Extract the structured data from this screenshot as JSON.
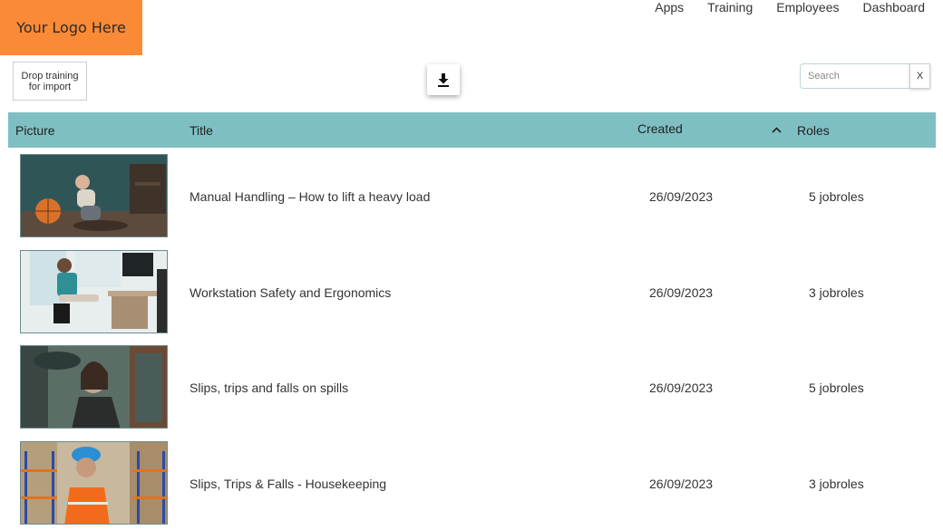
{
  "logo": {
    "text": "Your Logo Here"
  },
  "nav": {
    "items": [
      "Apps",
      "Training",
      "Employees",
      "Dashboard"
    ]
  },
  "toolbar": {
    "drop_label_line1": "Drop training",
    "drop_label_line2": "for import",
    "download_icon": "download-icon"
  },
  "search": {
    "placeholder": "Search",
    "value": "",
    "clear_label": "X"
  },
  "table": {
    "columns": {
      "picture": "Picture",
      "title": "Title",
      "created": "Created",
      "roles": "Roles"
    },
    "sort": {
      "column": "created",
      "direction": "ascending",
      "icon": "chevron-up-icon"
    },
    "header_color": "#7ebfc4",
    "rows": [
      {
        "title": "Manual Handling – How to lift a heavy load",
        "created": "26/09/2023",
        "roles": "5 jobroles",
        "image": "child-with-basketball"
      },
      {
        "title": "Workstation Safety and Ergonomics",
        "created": "26/09/2023",
        "roles": "3 jobroles",
        "image": "woman-at-desk"
      },
      {
        "title": "Slips, trips and falls on spills",
        "created": "26/09/2023",
        "roles": "5 jobroles",
        "image": "woman-in-rain"
      },
      {
        "title": "Slips, Trips & Falls - Housekeeping",
        "created": "26/09/2023",
        "roles": "3 jobroles",
        "image": "worker-in-warehouse"
      }
    ]
  },
  "colors": {
    "logo_bg": "#fb8a37",
    "header_bg": "#7ebfc4"
  }
}
